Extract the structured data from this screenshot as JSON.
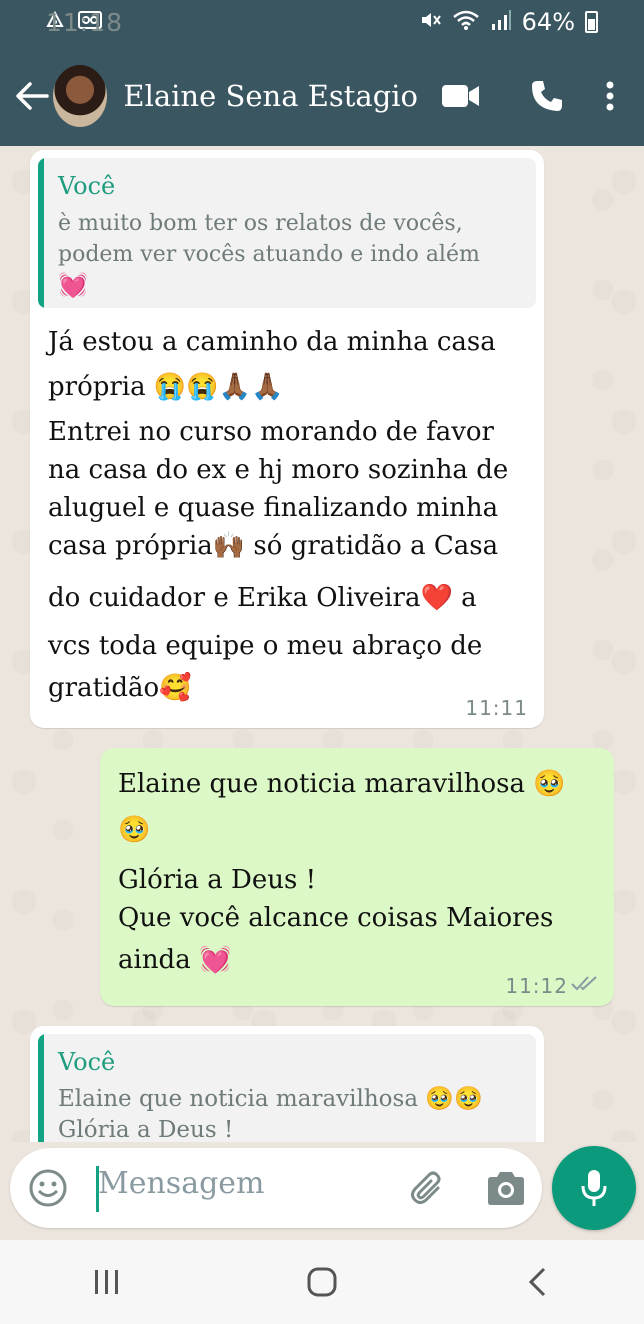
{
  "status_bar": {
    "time": "11:18",
    "battery": "64%",
    "icons": [
      "drive-icon",
      "voicemail-icon",
      "mute-icon",
      "wifi-icon",
      "signal-icon",
      "battery-icon"
    ]
  },
  "header": {
    "contact_name": "Elaine Sena Estagio",
    "icons": [
      "back-arrow-icon",
      "video-call-icon",
      "phone-icon",
      "more-vert-icon"
    ]
  },
  "messages": [
    {
      "direction": "incoming",
      "quote": {
        "author": "Você",
        "lines": [
          "è muito bom ter os relatos de vocês,",
          "podem ver vocês atuando e indo além",
          "💓"
        ]
      },
      "lines": [
        "Já estou a caminho da minha casa",
        "própria 😭😭🙏🏾🙏🏾",
        "Entrei no curso morando de favor",
        "na casa do ex e hj moro sozinha de",
        "aluguel e quase finalizando minha",
        "casa própria🙌🏾 só gratidão a Casa",
        "do cuidador e Erika Oliveira❤️ a",
        "vcs toda equipe o meu abraço de",
        "gratidão🥰"
      ],
      "time": "11:11"
    },
    {
      "direction": "outgoing",
      "lines": [
        "Elaine que noticia maravilhosa 🥹",
        "🥹",
        "Glória a Deus !",
        "Que você alcance coisas Maiores",
        "ainda 💓"
      ],
      "time": "11:12",
      "status": "read"
    },
    {
      "direction": "incoming",
      "quote": {
        "author": "Você",
        "lines": [
          "Elaine que noticia maravilhosa 🥹🥹",
          "Glória a Deus !"
        ]
      }
    }
  ],
  "composer": {
    "placeholder": "Mensagem"
  },
  "colors": {
    "header": "#3a5660",
    "accent": "#13a384",
    "outgoing_bubble": "#dcf8c6",
    "incoming_bubble": "#ffffff"
  }
}
